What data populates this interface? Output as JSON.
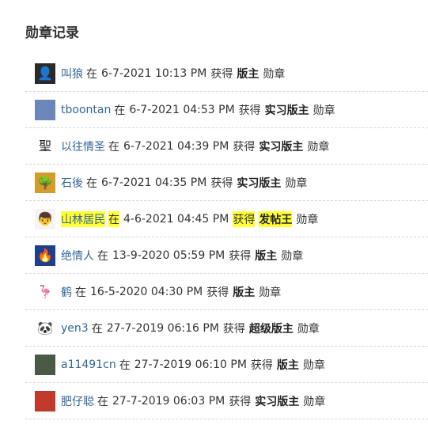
{
  "title": "勋章记录",
  "labels": {
    "at": "在",
    "got": "获得",
    "medal": "勋章"
  },
  "colors": {
    "link": "#336699",
    "highlight": "#ffff33"
  },
  "records": [
    {
      "user": "叫狼",
      "date": "6-7-2021 10:13 PM",
      "badge": "版主",
      "avatar_icon": "person-photo-avatar",
      "avatar_glyph": "👤",
      "avatar_bg": "#2a2a2a",
      "avatar_fg": "#bbbbbb"
    },
    {
      "user": "tboontan",
      "date": "6-7-2021 04:53 PM",
      "badge": "实习版主",
      "avatar_icon": "landscape-photo-avatar",
      "avatar_glyph": "",
      "avatar_bg": "#6b86b8",
      "avatar_fg": "#ffffff"
    },
    {
      "user": "以往情圣",
      "date": "6-7-2021 04:39 PM",
      "badge": "实习版主",
      "avatar_icon": "calligraphy-character-avatar",
      "avatar_glyph": "聖",
      "avatar_bg": "#ffffff",
      "avatar_fg": "#222222"
    },
    {
      "user": "石後",
      "date": "6-7-2021 04:35 PM",
      "badge": "实习版主",
      "avatar_icon": "tree-photo-avatar",
      "avatar_glyph": "🌳",
      "avatar_bg": "#d79b2a",
      "avatar_fg": "#2d6b1f"
    },
    {
      "user": "山林居民",
      "date": "4-6-2021 04:45 PM",
      "badge": "发帖王",
      "avatar_icon": "face-avatar",
      "avatar_glyph": "👦",
      "avatar_bg": "#f4f4f4",
      "avatar_fg": "#333333",
      "highlighted": true
    },
    {
      "user": "绝情人",
      "date": "13-9-2020 05:59 PM",
      "badge": "版主",
      "avatar_icon": "fire-face-avatar",
      "avatar_glyph": "🔥",
      "avatar_bg": "#1f3f8a",
      "avatar_fg": "#ff6a00"
    },
    {
      "user": "鹤",
      "date": "16-5-2020 04:30 PM",
      "badge": "版主",
      "avatar_icon": "crane-drawing-avatar",
      "avatar_glyph": "🦩",
      "avatar_bg": "#ffffff",
      "avatar_fg": "#c0392b"
    },
    {
      "user": "yen3",
      "date": "27-7-2019 06:16 PM",
      "badge": "超级版主",
      "avatar_icon": "cartoon-avatar",
      "avatar_glyph": "🐼",
      "avatar_bg": "#ffffff",
      "avatar_fg": "#444444"
    },
    {
      "user": "a11491cn",
      "date": "27-7-2019 06:10 PM",
      "badge": "版主",
      "avatar_icon": "sky-photo-avatar",
      "avatar_glyph": "",
      "avatar_bg": "#4a5a44",
      "avatar_fg": "#ffffff"
    },
    {
      "user": "肥仔聪",
      "date": "27-7-2019 06:03 PM",
      "badge": "实习版主",
      "avatar_icon": "red-photo-avatar",
      "avatar_glyph": "",
      "avatar_bg": "#c0392b",
      "avatar_fg": "#ffd54f"
    }
  ]
}
